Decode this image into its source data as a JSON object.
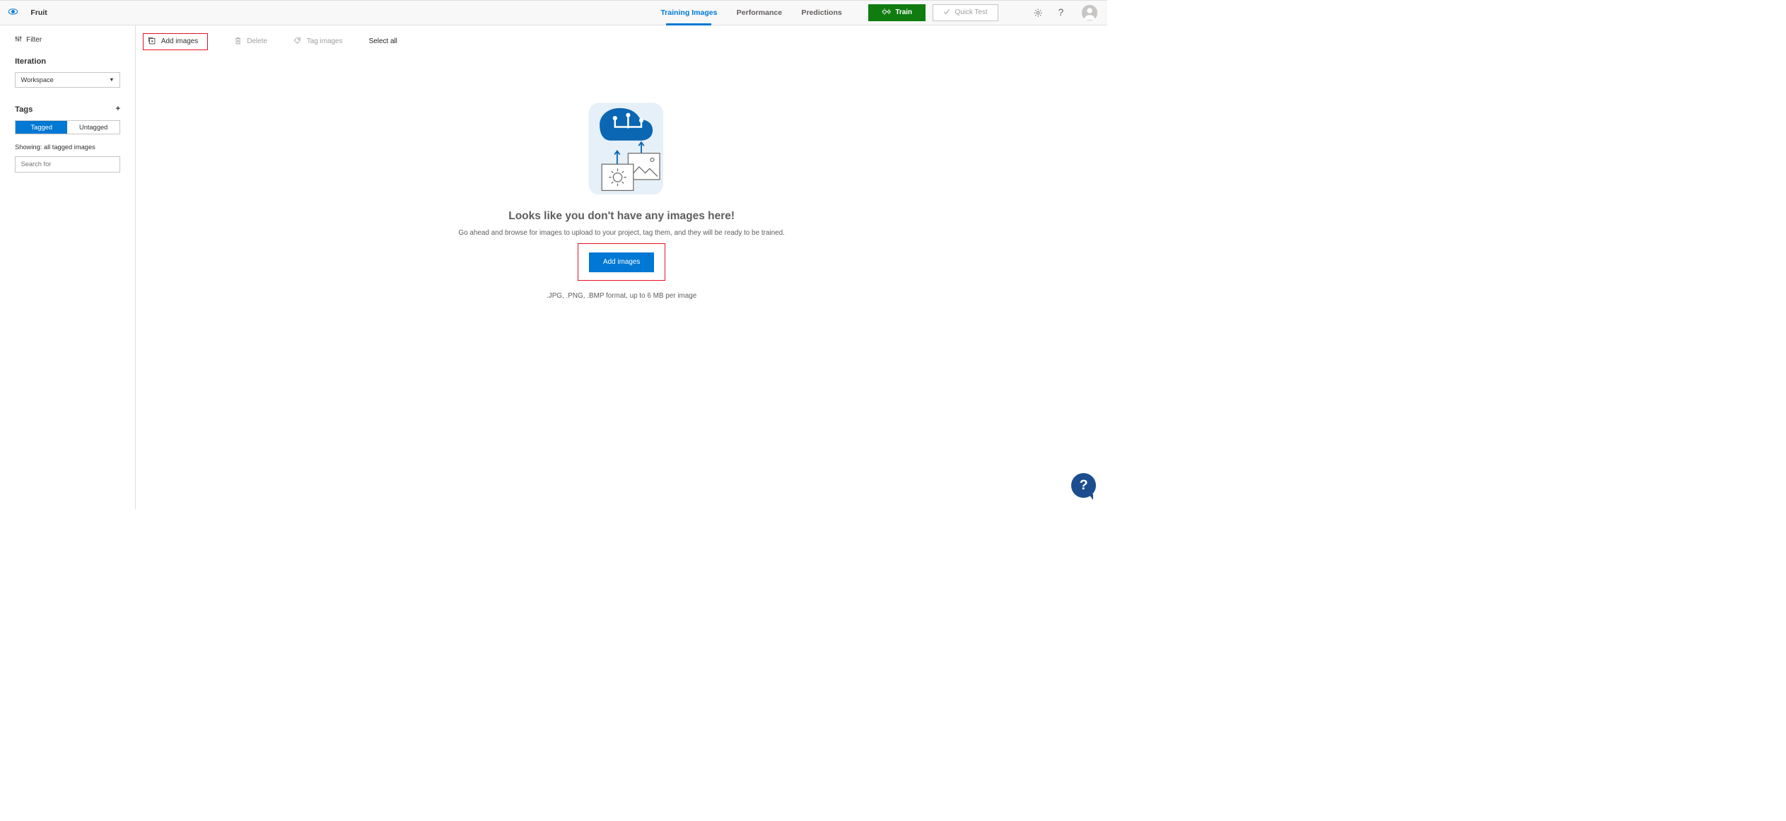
{
  "project_name": "Fruit",
  "tabs": [
    "Training Images",
    "Performance",
    "Predictions"
  ],
  "active_tab_index": 0,
  "train_button": "Train",
  "quick_test_button": "Quick Test",
  "sidebar": {
    "filter_label": "Filter",
    "iteration_heading": "Iteration",
    "iteration_selected": "Workspace",
    "tags_heading": "Tags",
    "segmented": {
      "tagged": "Tagged",
      "untagged": "Untagged"
    },
    "showing_text": "Showing: all tagged images",
    "search_placeholder": "Search for"
  },
  "toolbar": {
    "add_images": "Add images",
    "delete": "Delete",
    "tag_images": "Tag images",
    "select_all": "Select all"
  },
  "empty_state": {
    "title": "Looks like you don't have any images here!",
    "subtitle": "Go ahead and browse for images to upload to your project, tag them, and they will be ready to be trained.",
    "add_button": "Add images",
    "formats": ".JPG, .PNG, .BMP format, up to 6 MB per image"
  }
}
